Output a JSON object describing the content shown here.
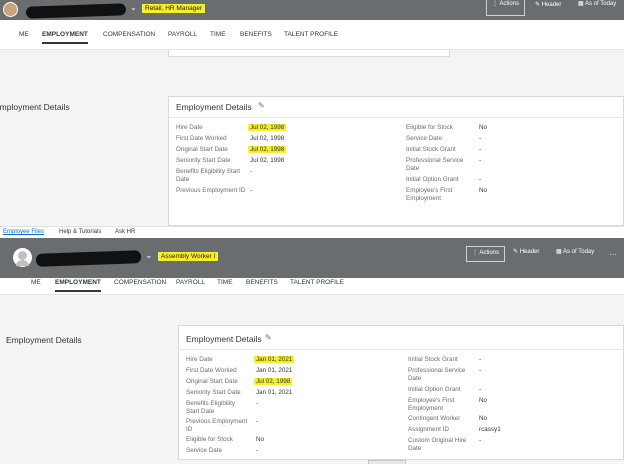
{
  "top": {
    "role": "Retail, HR Manager",
    "actions": "Actions",
    "header": "Header",
    "as_of_today": "As of Today",
    "tabs": [
      "ME",
      "EMPLOYMENT",
      "COMPENSATION",
      "PAYROLL",
      "TIME",
      "BENEFITS",
      "TALENT PROFILE"
    ],
    "section_title": "Employment Details",
    "card_title": "Employment Details",
    "left_labels": [
      "Hire Date",
      "First Date Worked",
      "Original Start Date",
      "Seniority Start Date",
      "Benefits Eligibility Start Date",
      "Previous Employment ID"
    ],
    "left_values": [
      "Jul 02, 1998",
      "Jul 02, 1998",
      "Jul 02, 1998",
      "Jul 02, 1998",
      "-",
      "-"
    ],
    "right_labels": [
      "Eligible for Stock",
      "Service Date",
      "Initial Stock Grant",
      "Professional Service Date",
      "Initial Option Grant",
      "Employee's First Employment"
    ],
    "right_values": [
      "No",
      "-",
      "-",
      "-",
      "-",
      "No"
    ]
  },
  "footer": {
    "employee_files": "Employee Files",
    "help": "Help & Tutorials",
    "ask_hr": "Ask HR"
  },
  "bottom": {
    "role": "Assembly Worker I",
    "actions": "Actions",
    "header": "Header",
    "as_of_today": "As of Today",
    "more": "···",
    "tabs": [
      "ME",
      "EMPLOYMENT",
      "COMPENSATION",
      "PAYROLL",
      "TIME",
      "BENEFITS",
      "TALENT PROFILE"
    ],
    "section_title": "Employment Details",
    "card_title": "Employment Details",
    "left_labels": [
      "Hire Date",
      "First Date Worked",
      "Original Start Date",
      "Seniority Start Date",
      "Benefits Eligibility Start Date",
      "Previous Employment ID",
      "Eligible for Stock",
      "Service Date"
    ],
    "left_values": [
      "Jan 01, 2021",
      "Jan 01, 2021",
      "Jul 02, 1998",
      "Jan 01, 2021",
      "-",
      "-",
      "No",
      "-"
    ],
    "right_labels": [
      "Initial Stock Grant",
      "Professional Service Date",
      "Initial Option Grant",
      "Employee's First Employment",
      "Contingent Worker",
      "Assignment ID",
      "Custom Original Hire Date"
    ],
    "right_values": [
      "-",
      "-",
      "-",
      "No",
      "No",
      "rcassy1",
      "-"
    ]
  }
}
